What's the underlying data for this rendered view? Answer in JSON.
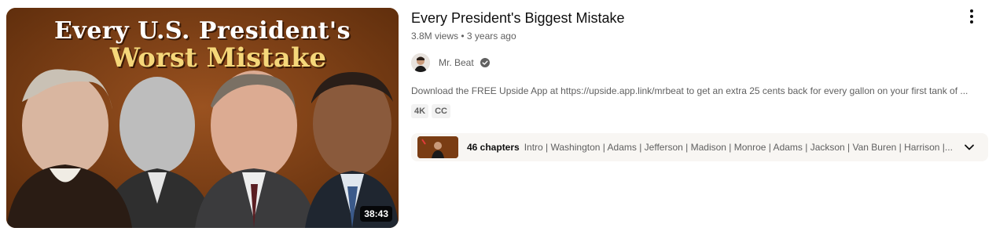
{
  "video": {
    "thumbnail": {
      "title_line1": "Every U.S. President's",
      "title_line2": "Worst Mistake",
      "duration": "38:43"
    },
    "title": "Every President's Biggest Mistake",
    "views": "3.8M views",
    "age": "3 years ago",
    "meta_separator": "•",
    "channel": {
      "name": "Mr. Beat",
      "verified": true
    },
    "description": "Download the FREE Upside App at https://upside.app.link/mrbeat to get an extra 25 cents back for every gallon on your first tank of ...",
    "badges": [
      "4K",
      "CC"
    ],
    "chapters": {
      "count_label": "46 chapters",
      "list": "Intro | Washington | Adams | Jefferson | Madison | Monroe | Adams | Jackson | Van Buren | Harrison |..."
    }
  },
  "icons": {
    "menu": "more-vert-icon",
    "verified": "verified-check-icon",
    "expand": "chevron-down-icon"
  },
  "colors": {
    "thumbnail_bg": "#7a3d14",
    "title_white": "#ffffff",
    "title_yellow": "#f5d77a",
    "secondary_text": "#606060",
    "chapters_bg": "#f8f6f3"
  }
}
